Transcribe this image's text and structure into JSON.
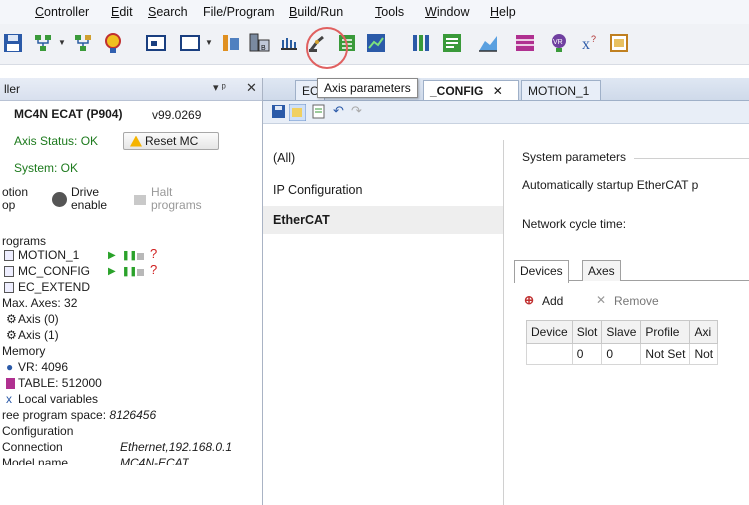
{
  "menu": {
    "items": [
      {
        "pre": "",
        "u": "C",
        "post": "ontroller"
      },
      {
        "pre": "",
        "u": "E",
        "post": "dit"
      },
      {
        "pre": "",
        "u": "S",
        "post": "earch"
      },
      {
        "pre": "File/Pro",
        "u": "g",
        "post": "ram"
      },
      {
        "pre": "",
        "u": "B",
        "post": "uild/Run"
      },
      {
        "pre": "",
        "u": "T",
        "post": "ools"
      },
      {
        "pre": "",
        "u": "W",
        "post": "indow"
      },
      {
        "pre": "",
        "u": "H",
        "post": "elp"
      }
    ]
  },
  "toolbar": {
    "tooltip": "Axis parameters",
    "icons": [
      "save-icon",
      "network-icon",
      "network-config-icon",
      "scope-icon",
      "terminal-icon",
      "window-icon",
      "axis-config-icon",
      "axis-parameters-icon",
      "jog-icon",
      "robot-icon",
      "io-icon",
      "chart-icon",
      "plc-icon",
      "graph-icon",
      "area-chart-icon",
      "table-icon",
      "vr-icon",
      "variables-icon",
      "panel-icon"
    ]
  },
  "left_panel": {
    "title": "ller",
    "controller": "MC4N ECAT (P904)",
    "version": "v99.0269",
    "axis_status": "Axis Status: OK",
    "reset_label": "Reset MC",
    "system_status": "System: OK",
    "motion_top": "otion",
    "motion_bottom": "op",
    "drive_top": "Drive",
    "drive_bottom": "enable",
    "halt_top": "Halt",
    "halt_bottom": "programs",
    "programs_header": "rograms",
    "programs": [
      "MOTION_1",
      "MC_CONFIG",
      "EC_EXTEND"
    ],
    "max_axes": "Max. Axes: 32",
    "axes": [
      "Axis (0)",
      "Axis (1)"
    ],
    "memory_header": "Memory",
    "vr": "VR: 4096",
    "table": "TABLE: 512000",
    "local_variables": "Local variables",
    "free_space_label": "ree program space:",
    "free_space_value": "8126456",
    "configuration_header": "Configuration",
    "connection_label": "Connection",
    "connection_value": "Ethernet,192.168.0.1",
    "model_label": "Model name",
    "model_value": "MC4N-ECAT"
  },
  "tabs": [
    "EC",
    "_CONFIG",
    "MOTION_1"
  ],
  "categories": [
    "(All)",
    "IP Configuration",
    "EtherCAT"
  ],
  "content": {
    "system_parameters": "System parameters",
    "auto_startup": "Automatically startup EtherCAT p",
    "network_cycle": "Network cycle time:",
    "subtabs": [
      "Devices",
      "Axes"
    ],
    "add_label": "Add",
    "remove_label": "Remove",
    "columns": [
      "Device",
      "Slot",
      "Slave",
      "Profile",
      "Axi"
    ],
    "rows": [
      [
        "",
        "0",
        "0",
        "Not Set",
        "Not"
      ]
    ]
  },
  "colors": {
    "accent": "#e06060",
    "ok_green": "#1d7a1d",
    "warning": "#f5b400"
  }
}
